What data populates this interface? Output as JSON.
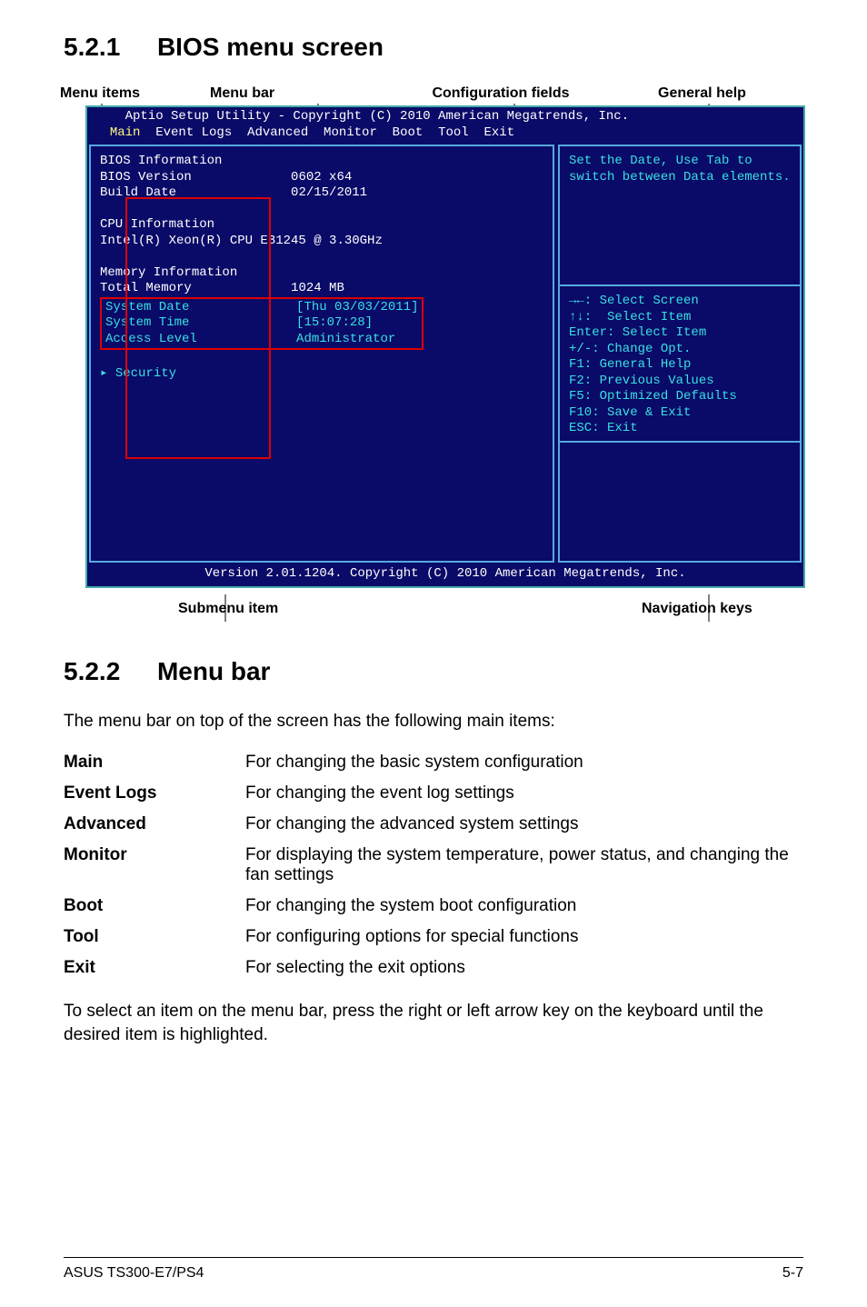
{
  "section1": {
    "num": "5.2.1",
    "title": "BIOS menu screen"
  },
  "labels": {
    "menu_items": "Menu items",
    "menu_bar": "Menu bar",
    "config_fields": "Configuration fields",
    "general_help": "General help",
    "submenu_item": "Submenu item",
    "nav_keys": "Navigation keys"
  },
  "bios": {
    "header": "    Aptio Setup Utility - Copyright (C) 2010 American Megatrends, Inc.",
    "tabs": {
      "active": "Main",
      "rest": "  Event Logs  Advanced  Monitor  Boot  Tool  Exit"
    },
    "left": {
      "l1": "BIOS Information",
      "l2a": "BIOS Version",
      "l2b": "0602 x64",
      "l3a": "Build Date",
      "l3b": "02/15/2011",
      "l4": "CPU Information",
      "l5": "Intel(R) Xeon(R) CPU E31245 @ 3.30GHz",
      "l6": "Memory Information",
      "l7a": "Total Memory",
      "l7b": "1024 MB",
      "sd": "System Date",
      "sdval": "[Thu 03/03/2011]",
      "st": "System Time",
      "stval": "[15:07:28]",
      "al": "Access Level",
      "alval": "Administrator",
      "sec": "Security"
    },
    "help_top": "Set the Date, Use Tab to\nswitch between Data elements.",
    "help_nav": "→←: Select Screen\n↑↓:  Select Item\nEnter: Select Item\n+/-: Change Opt.\nF1: General Help\nF2: Previous Values\nF5: Optimized Defaults\nF10: Save & Exit\nESC: Exit",
    "footer": "Version 2.01.1204. Copyright (C) 2010 American Megatrends, Inc."
  },
  "section2": {
    "num": "5.2.2",
    "title": "Menu bar"
  },
  "intro2": "The menu bar on top of the screen has the following main items:",
  "defs": {
    "Main": "For changing the basic system configuration",
    "EventLogs_term": "Event Logs",
    "EventLogs": "For changing the event log settings",
    "Advanced": "For changing the advanced system settings",
    "Monitor": "For displaying the system temperature, power status, and changing the fan settings",
    "Boot": "For changing the system boot configuration",
    "Tool": "For configuring options for special functions",
    "Exit": "For selecting the exit options"
  },
  "outro2": "To select an item on the menu bar, press the right or left arrow key on the keyboard until the desired item is highlighted.",
  "footer": {
    "left": "ASUS TS300-E7/PS4",
    "right": "5-7"
  }
}
